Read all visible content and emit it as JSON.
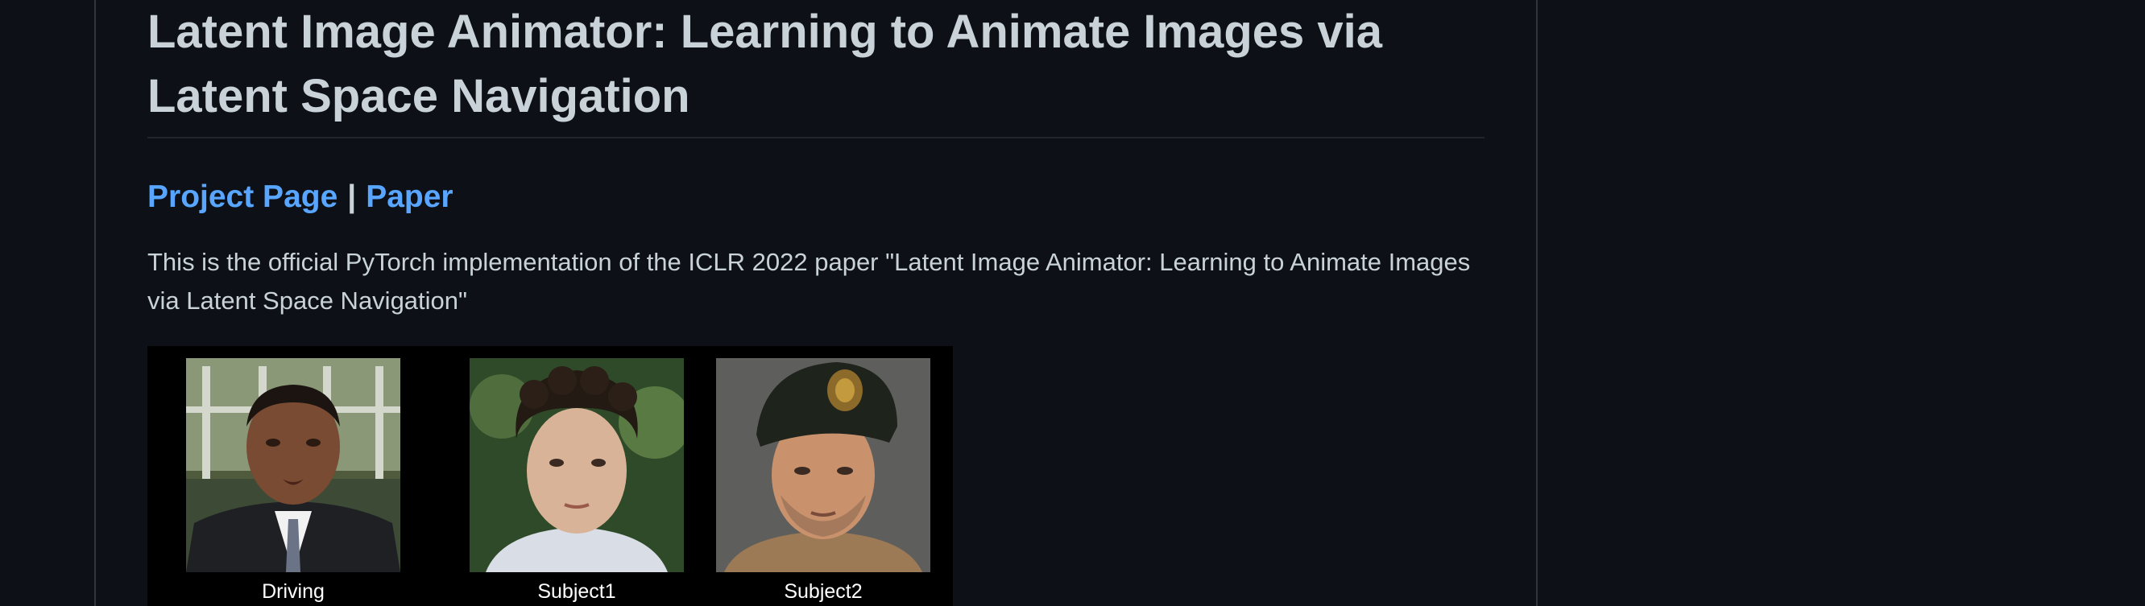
{
  "readme": {
    "title": "Latent Image Animator: Learning to Animate Images via Latent Space Navigation",
    "links": {
      "project_page": "Project Page",
      "separator": "|",
      "paper": "Paper"
    },
    "description": "This is the official PyTorch implementation of the ICLR 2022 paper \"Latent Image Animator: Learning to Animate Images via Latent Space Navigation\"",
    "demo": {
      "captions": [
        "Driving",
        "Subject1",
        "Subject2"
      ]
    }
  },
  "colors": {
    "background": "#0d1117",
    "text": "#c9d1d9",
    "link": "#58a6ff",
    "border": "#30363d"
  }
}
